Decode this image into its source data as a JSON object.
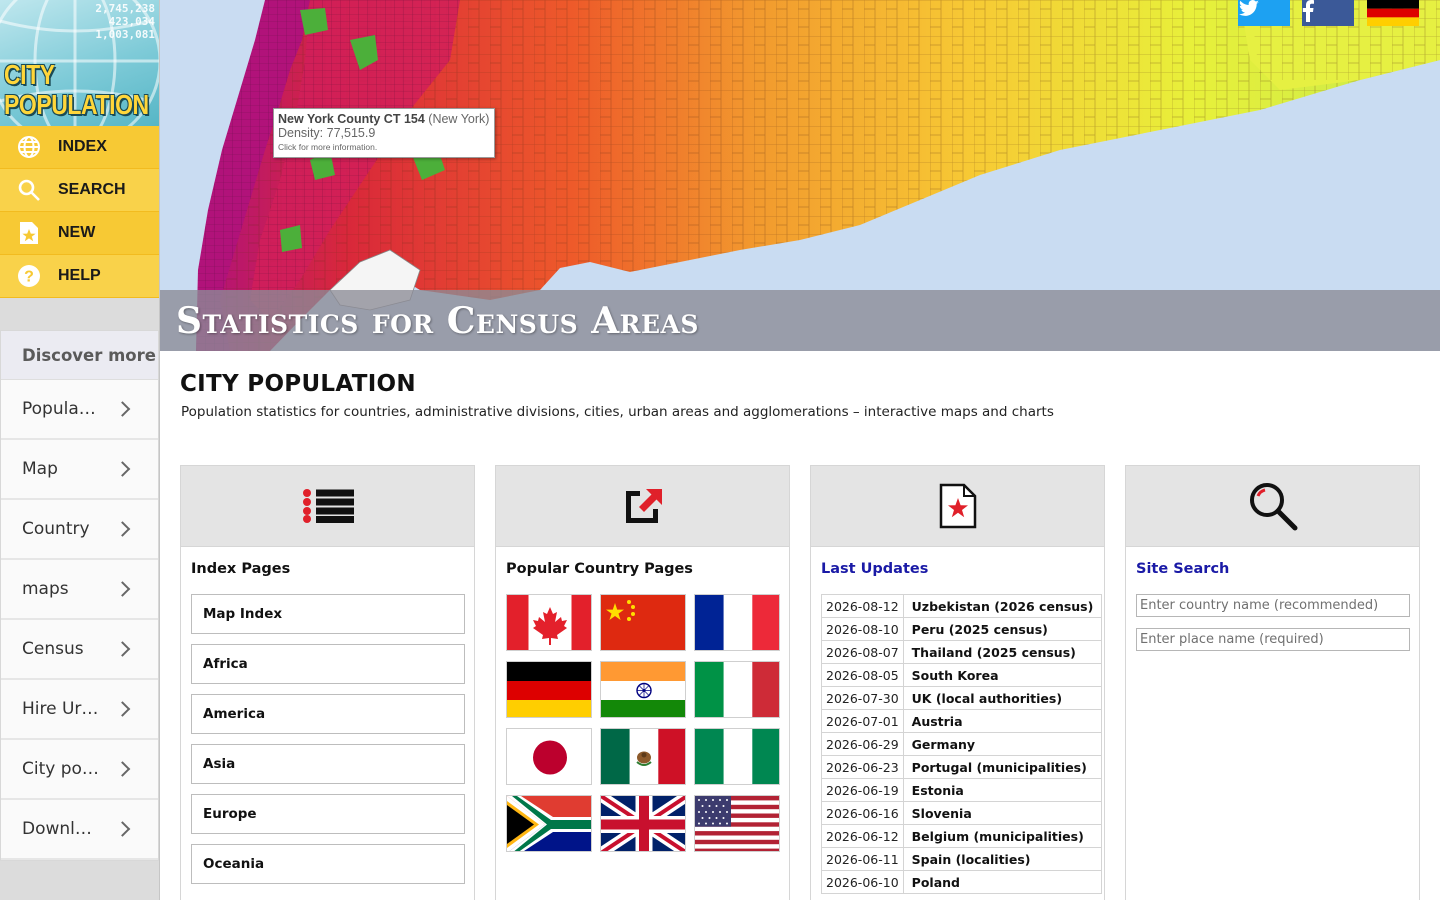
{
  "logo": {
    "stats": [
      "2,745,238",
      "423,034",
      "1,003,081"
    ],
    "line1": "CITY",
    "line2": "POPULATION"
  },
  "nav": [
    {
      "label": "INDEX",
      "icon": "globe-icon"
    },
    {
      "label": "SEARCH",
      "icon": "magnifier-icon"
    },
    {
      "label": "NEW",
      "icon": "new-star-icon"
    },
    {
      "label": "HELP",
      "icon": "question-icon"
    }
  ],
  "discover": {
    "heading": "Discover more",
    "items": [
      "Population",
      "Map",
      "Country",
      "maps",
      "Census",
      "Hire Urban",
      "City population",
      "Download"
    ]
  },
  "map": {
    "banner_title": "Statistics for Census Areas",
    "tooltip": {
      "name": "New York County CT 154",
      "region": "(New York)",
      "density": "Density: 77,515.9",
      "hint": "Click for more information."
    },
    "colors": {
      "water": "#c9dcf2",
      "land_low": "#e8f03a",
      "land_mid": "#f2a52e",
      "land_high": "#d9283a",
      "land_max": "#b1127a",
      "park": "#4caf3a"
    }
  },
  "social": {
    "twitter_icon": "twitter-icon",
    "facebook_icon": "facebook-icon",
    "language_icon": "german-flag-icon"
  },
  "page": {
    "title": "CITY POPULATION",
    "subtitle": "Population statistics for countries, administrative divisions, cities, urban areas and agglomerations – interactive maps and charts"
  },
  "cards": {
    "index": {
      "title": "Index Pages",
      "icon": "list-icon",
      "items": [
        "Map Index",
        "Africa",
        "America",
        "Asia",
        "Europe",
        "Oceania"
      ]
    },
    "popular": {
      "title": "Popular Country Pages",
      "icon": "external-link-icon",
      "flags": [
        "Canada",
        "China",
        "France",
        "Germany",
        "India",
        "Italy",
        "Japan",
        "Mexico",
        "Nigeria",
        "South Africa",
        "United Kingdom",
        "United States"
      ]
    },
    "updates": {
      "title": "Last Updates",
      "icon": "new-page-icon",
      "rows": [
        {
          "date": "2026-08-12",
          "country": "Uzbekistan (2026 census)"
        },
        {
          "date": "2026-08-10",
          "country": "Peru (2025 census)"
        },
        {
          "date": "2026-08-07",
          "country": "Thailand (2025 census)"
        },
        {
          "date": "2026-08-05",
          "country": "South Korea"
        },
        {
          "date": "2026-07-30",
          "country": "UK (local authorities)"
        },
        {
          "date": "2026-07-01",
          "country": "Austria"
        },
        {
          "date": "2026-06-29",
          "country": "Germany"
        },
        {
          "date": "2026-06-23",
          "country": "Portugal (municipalities)"
        },
        {
          "date": "2026-06-19",
          "country": "Estonia"
        },
        {
          "date": "2026-06-16",
          "country": "Slovenia"
        },
        {
          "date": "2026-06-12",
          "country": "Belgium (municipalities)"
        },
        {
          "date": "2026-06-11",
          "country": "Spain (localities)"
        },
        {
          "date": "2026-06-10",
          "country": "Poland"
        }
      ]
    },
    "search": {
      "title": "Site Search",
      "icon": "search-icon",
      "country_placeholder": "Enter country name (recommended)",
      "place_placeholder": "Enter place name (required)"
    }
  }
}
